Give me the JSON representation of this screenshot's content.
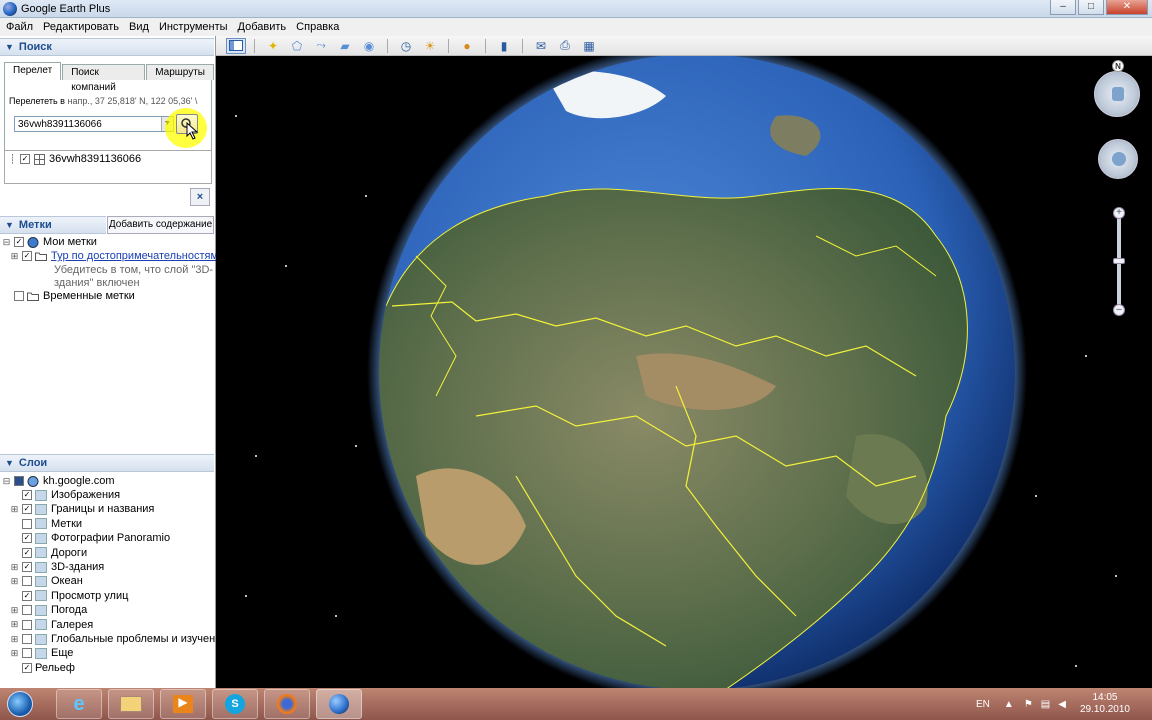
{
  "window": {
    "title": "Google Earth Plus"
  },
  "menu": [
    "Файл",
    "Редактировать",
    "Вид",
    "Инструменты",
    "Добавить",
    "Справка"
  ],
  "toolbar": {
    "buttons": [
      "sidebar-icon",
      "placemark-icon",
      "polygon-icon",
      "path-icon",
      "overlay-icon",
      "tour-icon",
      "historical-imagery-icon",
      "sunlight-icon",
      "planet-icon",
      "ruler-icon",
      "email-icon",
      "print-icon",
      "maps-icon"
    ]
  },
  "search": {
    "header": "Поиск",
    "tabs": [
      "Перелет",
      "Поиск компаний",
      "Маршруты"
    ],
    "fly_to_label": "Перелететь в",
    "fly_to_hint": "напр., 37 25,818' N, 122 05,36' \\",
    "input_value": "36vwh8391136066",
    "result": "36vwh8391136066",
    "close_label": "×"
  },
  "places": {
    "header": "Метки",
    "add_content": "Добавить содержание",
    "my_places": "Мои метки",
    "tour_link": "Тур по достопримечательностям",
    "tour_note_1": "Убедитесь в том, что слой \"3D-",
    "tour_note_2": "здания\" включен",
    "temporary": "Временные метки"
  },
  "layers": {
    "header": "Слои",
    "root": "kh.google.com",
    "items": [
      {
        "label": "Изображения",
        "checked": true,
        "expand": false,
        "icon": "imagery-icon"
      },
      {
        "label": "Границы и названия",
        "checked": true,
        "expand": true,
        "icon": "borders-icon"
      },
      {
        "label": "Метки",
        "checked": false,
        "expand": false,
        "icon": "labels-icon"
      },
      {
        "label": "Фотографии Panoramio",
        "checked": true,
        "expand": false,
        "icon": "photos-icon"
      },
      {
        "label": "Дороги",
        "checked": true,
        "expand": false,
        "icon": "roads-icon"
      },
      {
        "label": "3D-здания",
        "checked": true,
        "expand": true,
        "icon": "buildings-icon"
      },
      {
        "label": "Океан",
        "checked": false,
        "expand": true,
        "icon": "ocean-icon"
      },
      {
        "label": "Просмотр улиц",
        "checked": true,
        "expand": false,
        "icon": "street-view-icon"
      },
      {
        "label": "Погода",
        "checked": false,
        "expand": true,
        "icon": "weather-icon"
      },
      {
        "label": "Галерея",
        "checked": false,
        "expand": true,
        "icon": "gallery-icon"
      },
      {
        "label": "Глобальные проблемы и изучен…",
        "checked": false,
        "expand": true,
        "icon": "global-awareness-icon"
      },
      {
        "label": "Еще",
        "checked": false,
        "expand": true,
        "icon": "more-icon"
      },
      {
        "label": "Рельеф",
        "checked": true,
        "expand": false,
        "icon": ""
      }
    ]
  },
  "nav": {
    "north_label": "N"
  },
  "taskbar": {
    "apps": [
      "ie-icon",
      "explorer-icon",
      "media-player-icon",
      "skype-icon",
      "firefox-icon",
      "google-earth-icon"
    ],
    "lang": "EN",
    "time": "14:05",
    "date": "29.10.2010"
  },
  "colors": {
    "accent": "#1d4d8f",
    "border_yellow": "#f2f23a",
    "ocean": "#2b62b8"
  }
}
